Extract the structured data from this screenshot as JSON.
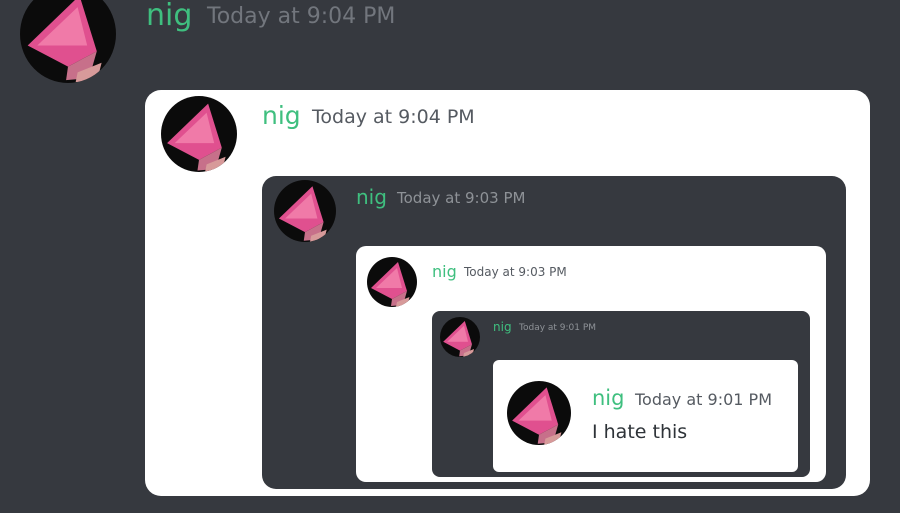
{
  "messages": [
    {
      "author": "nig",
      "timestamp": "Today at 9:04 PM"
    },
    {
      "author": "nig",
      "timestamp": "Today at 9:04 PM"
    },
    {
      "author": "nig",
      "timestamp": "Today at 9:03 PM"
    },
    {
      "author": "nig",
      "timestamp": "Today at 9:03 PM"
    },
    {
      "author": "nig",
      "timestamp": "Today at 9:01 PM"
    },
    {
      "author": "nig",
      "timestamp": "Today at 9:01 PM",
      "text": "I hate this"
    }
  ],
  "colors": {
    "background": "#36393f",
    "username": "#3fbf7f",
    "timestamp": "#72767d",
    "screenshot_frame": "#ffffff"
  },
  "icons": {
    "avatar": "pink-pyramid-avatar"
  }
}
